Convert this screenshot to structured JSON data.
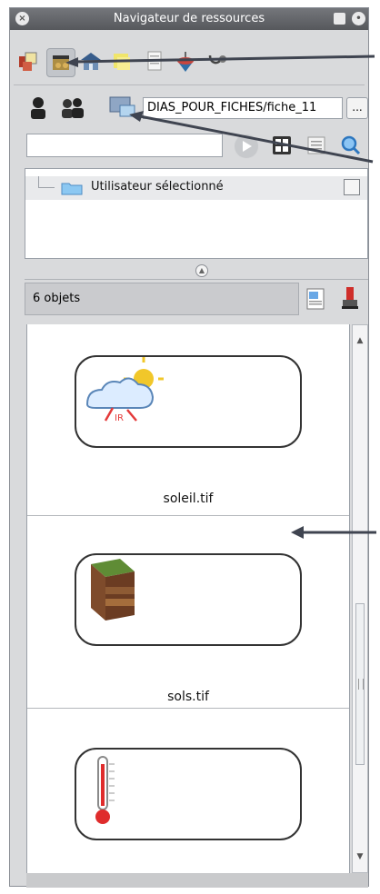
{
  "window": {
    "title": "Navigateur de ressources"
  },
  "toolbar": {
    "tools": [
      "media-objects-icon",
      "video-media-icon",
      "school-building-icon",
      "sticky-notes-icon",
      "document-icon",
      "spinning-top-icon",
      "stethoscope-icon"
    ],
    "active_tool": 1
  },
  "resource_selector": {
    "path_value": "DIAS_POUR_FICHES/fiche_11",
    "browse_label": "..."
  },
  "search": {
    "value": ""
  },
  "tree": {
    "selected_item": "Utilisateur sélectionné"
  },
  "objects": {
    "count_label": "6 objets",
    "items": [
      {
        "name": "soleil.tif",
        "icon": "sun-cloud-ir-icon"
      },
      {
        "name": "sols.tif",
        "icon": "soil-block-icon"
      },
      {
        "name": "",
        "icon": "thermometer-icon"
      }
    ]
  },
  "colors": {
    "title_bar": "#5f6165",
    "panel_bg": "#d9dadc",
    "arrow": "#3f4450"
  }
}
